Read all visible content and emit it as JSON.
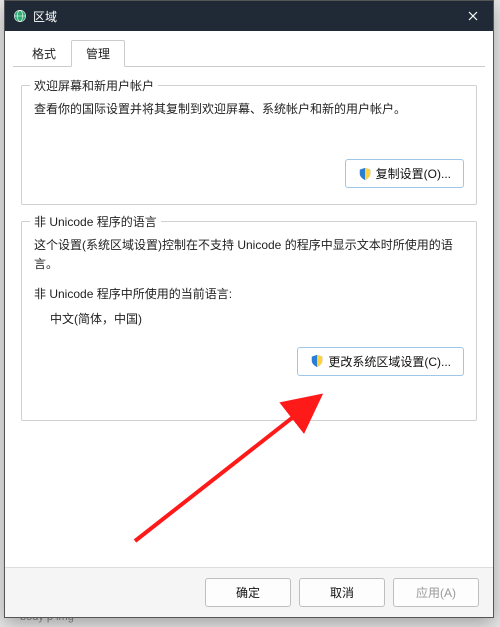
{
  "window": {
    "title": "区域",
    "close_label": "×"
  },
  "tabs": {
    "format": "格式",
    "admin": "管理"
  },
  "group1": {
    "title": "欢迎屏幕和新用户帐户",
    "desc": "查看你的国际设置并将其复制到欢迎屏幕、系统帐户和新的用户帐户。",
    "button": "复制设置(O)..."
  },
  "group2": {
    "title": "非 Unicode 程序的语言",
    "desc": "这个设置(系统区域设置)控制在不支持 Unicode 的程序中显示文本时所使用的语言。",
    "current_label": "非 Unicode 程序中所使用的当前语言:",
    "current_value": "中文(简体，中国)",
    "button": "更改系统区域设置(C)..."
  },
  "footer": {
    "ok": "确定",
    "cancel": "取消",
    "apply": "应用(A)"
  },
  "behind": {
    "text1": "body  p  img"
  }
}
